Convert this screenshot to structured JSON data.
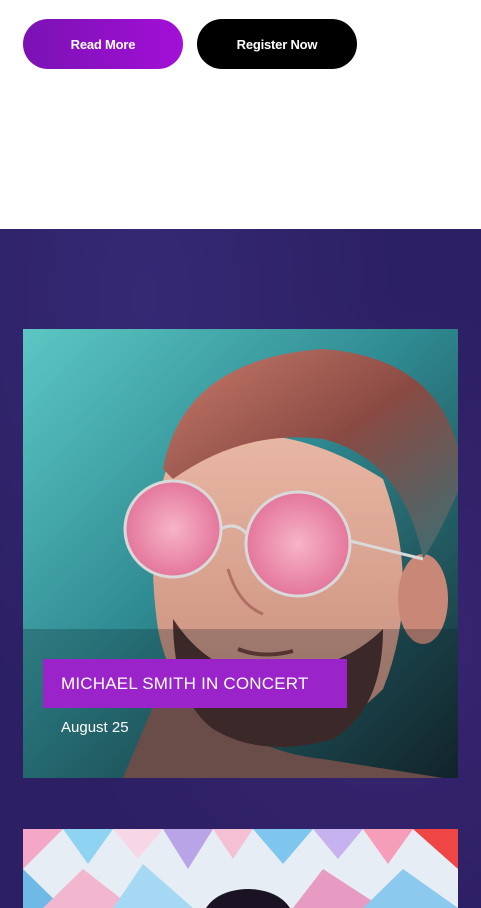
{
  "hero_actions": {
    "read_more_label": "Read More",
    "register_label": "Register Now"
  },
  "events": [
    {
      "title": "MICHAEL SMITH IN CONCERT",
      "date": "August 25"
    }
  ],
  "colors": {
    "accent_purple": "#9a23c9",
    "section_background": "#2c1f63",
    "register_button": "#000000"
  }
}
